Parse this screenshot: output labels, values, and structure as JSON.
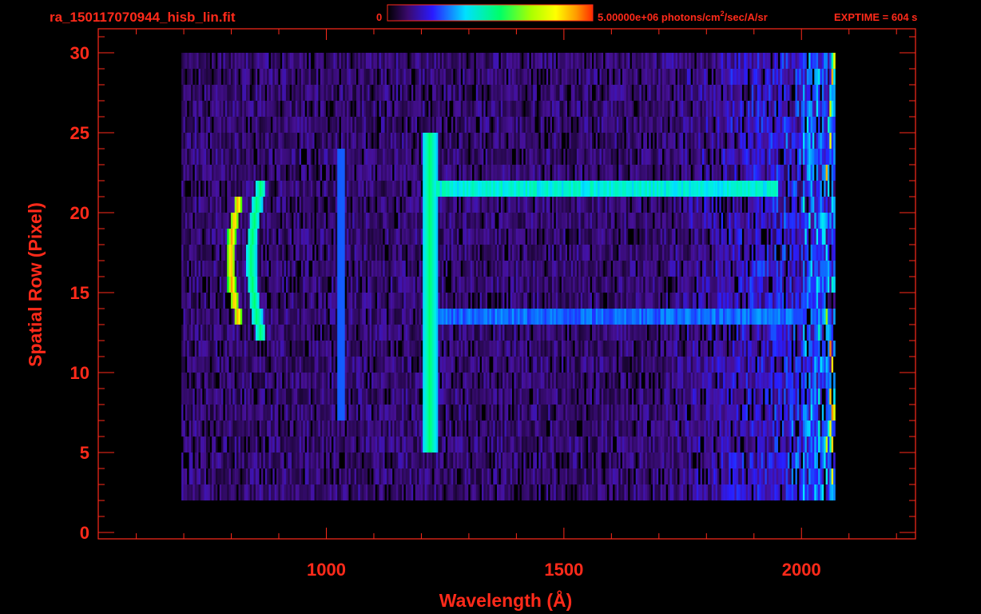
{
  "header": {
    "filename": "ra_150117070944_hisb_lin.fit",
    "colorbar_min": "0",
    "colorbar_max_prefix": "5.00000e+06 photons/cm",
    "colorbar_max_exp": "2",
    "colorbar_max_suffix": "/sec/A/sr",
    "exptime": "EXPTIME = 604 s"
  },
  "colors": {
    "axis": "#ff2a1a",
    "background": "#000000",
    "colormap": [
      "#000000",
      "#3a0a6e",
      "#4a10a8",
      "#2a1aff",
      "#0a7aff",
      "#00e0ff",
      "#00ff9a",
      "#00ff00",
      "#aaff00",
      "#ffff00",
      "#ff9a00",
      "#ff2a00"
    ]
  },
  "chart_data": {
    "type": "heatmap",
    "title": "ra_150117070944_hisb_lin.fit",
    "xlabel": "Wavelength (Å)",
    "ylabel": "Spatial Row (Pixel)",
    "xlim": [
      520,
      2240
    ],
    "ylim": [
      -0.4,
      31.5
    ],
    "xticks": [
      1000,
      1500,
      2000
    ],
    "xtick_labels": [
      "1000",
      "1500",
      "2000"
    ],
    "yticks": [
      0,
      5,
      10,
      15,
      20,
      25,
      30
    ],
    "ytick_labels": [
      "0",
      "5",
      "10",
      "15",
      "20",
      "25",
      "30"
    ],
    "colorbar_range": [
      0,
      5000000
    ],
    "colorbar_units": "photons/cm^2/sec/A/sr",
    "exposure_time_s": 604,
    "grid": false,
    "features": [
      {
        "name": "arc band",
        "wavelength_center": 815,
        "rows": [
          13,
          20
        ],
        "intensity": 0.95
      },
      {
        "name": "arc band",
        "wavelength_center": 855,
        "rows": [
          12,
          21
        ],
        "intensity": 0.6
      },
      {
        "name": "line",
        "wavelength_center": 1030,
        "rows": [
          7,
          23
        ],
        "intensity": 0.35
      },
      {
        "name": "line",
        "wavelength_center": 1216,
        "rows": [
          5,
          24
        ],
        "intensity": 0.6
      },
      {
        "name": "streak",
        "wavelength_range": [
          1230,
          1950
        ],
        "row": 21.5,
        "intensity": 0.45
      },
      {
        "name": "streak",
        "wavelength_range": [
          1230,
          2000
        ],
        "row": 13.5,
        "intensity": 0.3
      }
    ]
  }
}
